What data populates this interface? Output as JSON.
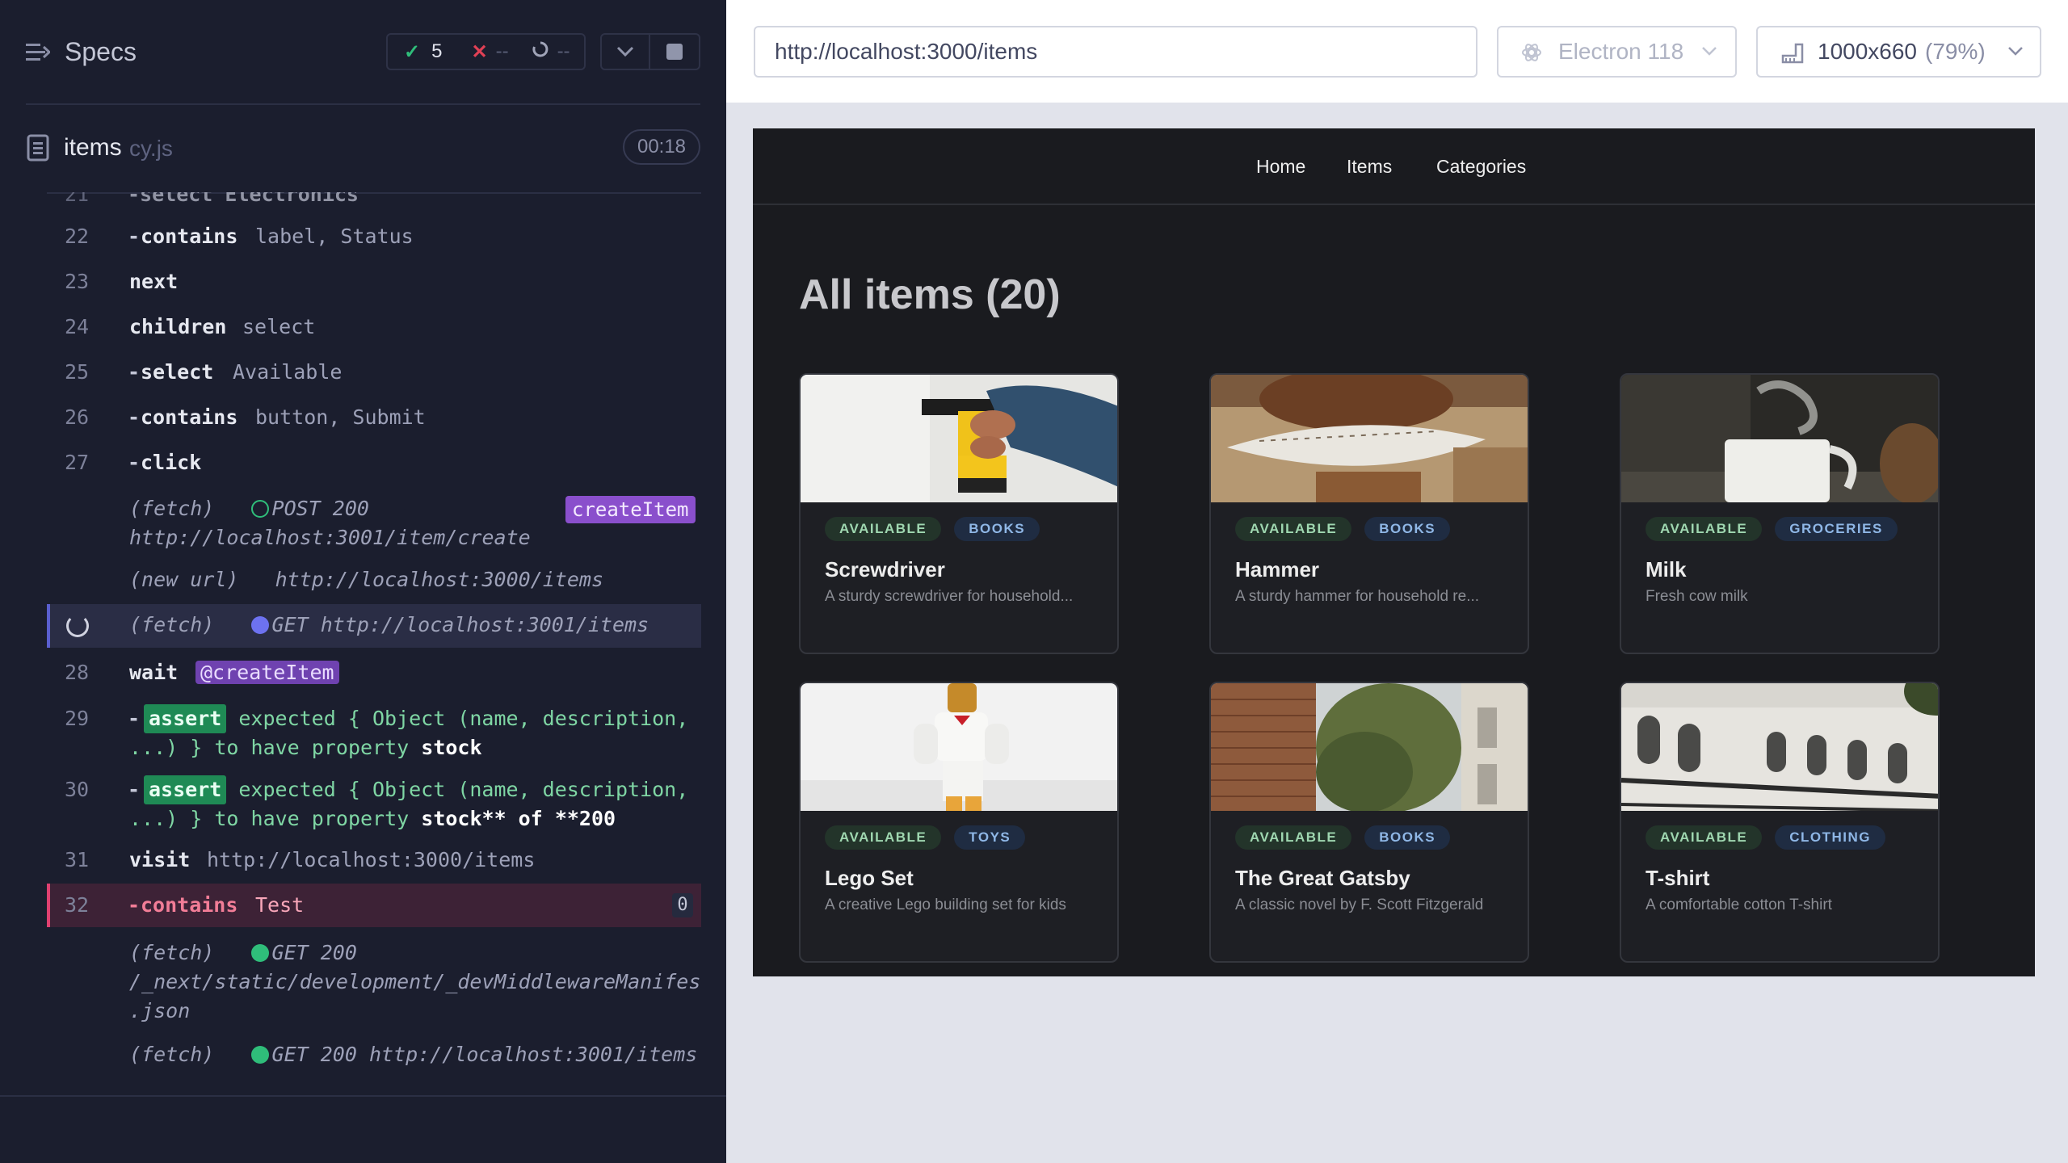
{
  "runner": {
    "title": "Specs",
    "stats": {
      "passed_icon": "check-icon",
      "passed": "5",
      "failed_icon": "x-icon",
      "failed": "--",
      "pending_icon": "spinner-icon",
      "pending": "--"
    },
    "spec": {
      "name": "items",
      "ext": "cy.js",
      "duration": "00:18"
    },
    "commands": [
      {
        "num": "22",
        "name": "contains",
        "arg": "label, Status",
        "child": true
      },
      {
        "num": "23",
        "name": "next",
        "arg": "",
        "child": false
      },
      {
        "num": "24",
        "name": "children",
        "arg": "select",
        "child": false
      },
      {
        "num": "25",
        "name": "select",
        "arg": "Available",
        "child": true
      },
      {
        "num": "26",
        "name": "contains",
        "arg": "button, Submit",
        "child": true
      },
      {
        "num": "27",
        "name": "click",
        "arg": "",
        "child": true
      }
    ],
    "log_post": {
      "label": "(fetch)",
      "method": "POST 200",
      "url": "http://localhost:3001/item/create",
      "alias": "createItem"
    },
    "log_newurl": {
      "label": "(new url)",
      "url": "http://localhost:3000/items"
    },
    "log_pending": {
      "label": "(fetch)",
      "method": "GET",
      "url": "http://localhost:3001/items"
    },
    "wait": {
      "num": "28",
      "name": "wait",
      "alias": "@createItem"
    },
    "asserts": [
      {
        "num": "29",
        "badge": "assert",
        "line1": "expected { Object (name, description,",
        "line2a": "...) }",
        "line2b": "to have property",
        "line2c": "stock"
      },
      {
        "num": "30",
        "badge": "assert",
        "line1": "expected { Object (name, description,",
        "line2a": "...) }",
        "line2b": "to have property",
        "line2c": "stock** of **200"
      }
    ],
    "visit": {
      "num": "31",
      "name": "visit",
      "arg": "http://localhost:3000/items"
    },
    "failed": {
      "num": "32",
      "name": "contains",
      "arg": "Test",
      "count": "0"
    },
    "log_manifest": {
      "label": "(fetch)",
      "method": "GET 200",
      "url1": "/_next/static/development/_devMiddlewareManifest",
      "url2": ".json"
    },
    "log_items": {
      "label": "(fetch)",
      "method": "GET 200",
      "url": "http://localhost:3001/items"
    },
    "partial_top": {
      "num": "21",
      "text": "-select Electronics"
    }
  },
  "browser": {
    "url": "http://localhost:3000/items",
    "browser_name": "Electron 118",
    "viewport": "1000x660",
    "scale": "(79%)"
  },
  "app": {
    "nav": [
      "Home",
      "Items",
      "Categories"
    ],
    "heading": "All items (20)",
    "items": [
      {
        "name": "Screwdriver",
        "desc": "A sturdy screwdriver for household...",
        "status": "AVAILABLE",
        "category": "BOOKS",
        "image": "drill-photo"
      },
      {
        "name": "Hammer",
        "desc": "A sturdy hammer for household re...",
        "status": "AVAILABLE",
        "category": "BOOKS",
        "image": "football-photo"
      },
      {
        "name": "Milk",
        "desc": "Fresh cow milk",
        "status": "AVAILABLE",
        "category": "GROCERIES",
        "image": "mug-photo"
      },
      {
        "name": "Lego Set",
        "desc": "A creative Lego building set for kids",
        "status": "AVAILABLE",
        "category": "TOYS",
        "image": "lego-photo"
      },
      {
        "name": "The Great Gatsby",
        "desc": "A classic novel by F. Scott Fitzgerald",
        "status": "AVAILABLE",
        "category": "BOOKS",
        "image": "building-photo"
      },
      {
        "name": "T-shirt",
        "desc": "A comfortable cotton T-shirt",
        "status": "AVAILABLE",
        "category": "CLOTHING",
        "image": "museum-photo"
      }
    ]
  }
}
